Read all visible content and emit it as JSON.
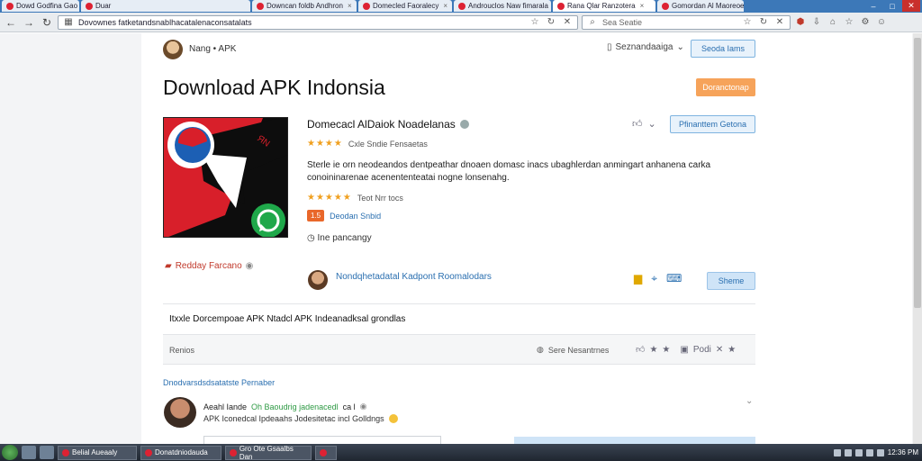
{
  "browser": {
    "tabs": [
      {
        "label": "Dowd Godfina Gao"
      },
      {
        "label": "Duar"
      },
      {
        "label": "Downcan foldb Andhron"
      },
      {
        "label": "Domecled Faoralecy"
      },
      {
        "label": "Androuclos Naw fimarala"
      },
      {
        "label": "Rana Qlar Ranzotera"
      },
      {
        "label": "Gomordan Al Maoreoea"
      }
    ],
    "url": "Dovownes fatketandsnablhacatalenaconsatalats",
    "search_placeholder": "Sea Seatie",
    "window_controls": [
      "–",
      "□",
      "✕"
    ]
  },
  "header": {
    "site_name": "Nang • APK",
    "language_label": "Seznandaaiga",
    "search_button": "Seoda Iams"
  },
  "page": {
    "title": "Download APK Indonsia",
    "promo_button": "Doranctonap"
  },
  "app": {
    "name": "Domecacl AlDaiok Noadelanas",
    "rating_stars": "★★★★",
    "rating_text": "Cxle Sndie Fensaetas",
    "description": "Sterle ie orn neodeandos dentpeathar dnoaen domasc inacs ubaghlerdan anmingart anhanena carka conoininarenae acenententeatai nogne lonsenahg.",
    "rating2_stars": "★★★★★",
    "rating2_text": "Teot Nrr tocs",
    "version_badge": "1.5",
    "developer_link": "Deodan Snbid",
    "install_note": "Ine pancangy",
    "download_button": "Pfinanttem Getona"
  },
  "related": {
    "label": "Redday Farcano",
    "developer_name": "Nondqhetadatal Kadpont Roomalodars",
    "share_button": "Sheme"
  },
  "section": {
    "heading_text": "Itxxle Dorcempoae APK Ntadcl APK Indeanadksal grondlas"
  },
  "reviews": {
    "label": "Renios",
    "middle_text": "Sere Nesantrnes",
    "right_text": "Podi"
  },
  "comments": {
    "header": "Dnodvarsdsdsatatste Pernaber",
    "author": "Aeahl Iande",
    "author_tag": "Oh Baoudrig jadenacedl",
    "author_meta": "ca l",
    "body": "APK Iconedcal Ipdeaahs Jodesitetac incl Golldngs"
  },
  "taskbar": {
    "items": [
      {
        "label": "Belial Aueaaly"
      },
      {
        "label": "Donatdniodauda"
      },
      {
        "label": "Gro Ote Gsaalbs Dan"
      }
    ],
    "clock": "12:36 PM"
  },
  "colors": {
    "accent_blue": "#2a6fb0",
    "promo_orange": "#f6a35a",
    "star": "#f0a020",
    "related_red": "#c0392b"
  }
}
